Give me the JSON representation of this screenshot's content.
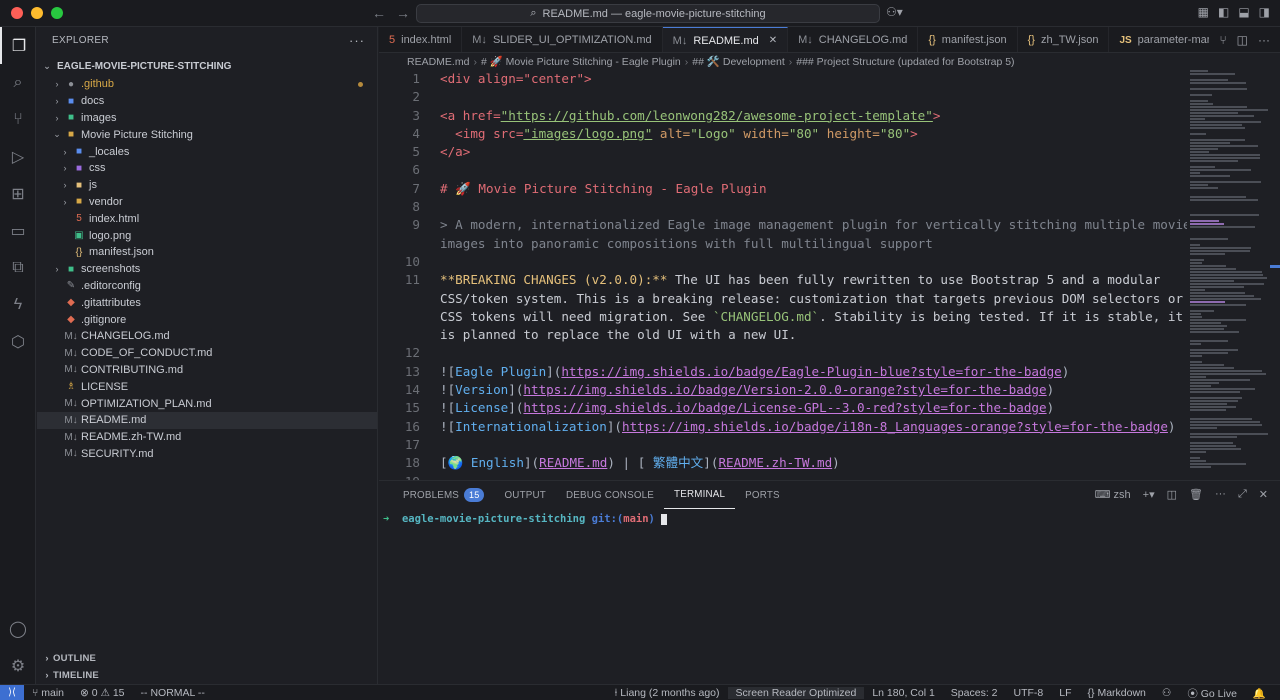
{
  "window": {
    "title": "README.md — eagle-movie-picture-stitching"
  },
  "sidebar": {
    "header": "EXPLORER",
    "project": "EAGLE-MOVIE-PICTURE-STITCHING",
    "items": [
      {
        "label": ".github",
        "icon": "github-folder-icon"
      },
      {
        "label": "docs",
        "icon": "folder-icon"
      },
      {
        "label": "images",
        "icon": "folder-icon"
      },
      {
        "label": "Movie Picture Stitching",
        "icon": "folder-open-icon"
      },
      {
        "label": "_locales",
        "icon": "folder-icon"
      },
      {
        "label": "css",
        "icon": "folder-icon"
      },
      {
        "label": "js",
        "icon": "folder-icon"
      },
      {
        "label": "vendor",
        "icon": "folder-icon"
      },
      {
        "label": "index.html",
        "icon": "html-file-icon"
      },
      {
        "label": "logo.png",
        "icon": "image-file-icon"
      },
      {
        "label": "manifest.json",
        "icon": "json-file-icon"
      },
      {
        "label": "screenshots",
        "icon": "folder-icon"
      },
      {
        "label": ".editorconfig",
        "icon": "config-file-icon"
      },
      {
        "label": ".gitattributes",
        "icon": "git-file-icon"
      },
      {
        "label": ".gitignore",
        "icon": "git-file-icon"
      },
      {
        "label": "CHANGELOG.md",
        "icon": "markdown-file-icon"
      },
      {
        "label": "CODE_OF_CONDUCT.md",
        "icon": "markdown-file-icon"
      },
      {
        "label": "CONTRIBUTING.md",
        "icon": "markdown-file-icon"
      },
      {
        "label": "LICENSE",
        "icon": "license-file-icon"
      },
      {
        "label": "OPTIMIZATION_PLAN.md",
        "icon": "markdown-file-icon"
      },
      {
        "label": "README.md",
        "icon": "markdown-file-icon"
      },
      {
        "label": "README.zh-TW.md",
        "icon": "markdown-file-icon"
      },
      {
        "label": "SECURITY.md",
        "icon": "markdown-file-icon"
      }
    ],
    "outline": "OUTLINE",
    "timeline": "TIMELINE"
  },
  "tabs": [
    {
      "label": "index.html",
      "icon": "html-file-icon"
    },
    {
      "label": "SLIDER_UI_OPTIMIZATION.md",
      "icon": "markdown-file-icon"
    },
    {
      "label": "README.md",
      "icon": "markdown-file-icon"
    },
    {
      "label": "CHANGELOG.md",
      "icon": "markdown-file-icon"
    },
    {
      "label": "manifest.json",
      "icon": "json-file-icon"
    },
    {
      "label": "zh_TW.json",
      "icon": "json-file-icon"
    },
    {
      "label": "parameter-manage",
      "icon": "js-file-icon"
    }
  ],
  "breadcrumb": [
    "README.md",
    "# 🚀 Movie Picture Stitching - Eagle Plugin",
    "## 🛠️ Development",
    "### Project Structure (updated for Bootstrap 5)"
  ],
  "editor": {
    "line_numbers": [
      "1",
      "2",
      "3",
      "4",
      "5",
      "6",
      "7",
      "8",
      "9",
      "",
      "10",
      "11",
      "",
      "",
      "",
      "12",
      "13",
      "14",
      "15",
      "16",
      "17",
      "18",
      "19"
    ],
    "l1": "<div align=\"center\">",
    "l3_a": "<a href=",
    "l3_url": "\"https://github.com/leonwong282/awesome-project-template\"",
    "l3_b": ">",
    "l4_a": "  <img src=",
    "l4_src": "\"images/logo.png\"",
    "l4_b": " alt=",
    "l4_alt": "\"Logo\"",
    "l4_c": " width=",
    "l4_w": "\"80\"",
    "l4_d": " height=",
    "l4_h": "\"80\"",
    "l4_e": ">",
    "l5": "</a>",
    "l7": "# 🚀 Movie Picture Stitching - Eagle Plugin",
    "l9_1": "> A modern, internationalized Eagle image management plugin for vertically stitching multiple movie",
    "l9_2": "images into panoramic compositions with full multilingual support",
    "l11_bold": "**BREAKING CHANGES (v2.0.0):**",
    "l11_1": " The UI has been fully rewritten to use Bootstrap 5 and a modular",
    "l11_2": "CSS/token system. This is a breaking release: customization that targets previous DOM selectors or",
    "l11_3a": "CSS tokens will need migration. See ",
    "l11_3code": "`CHANGELOG.md`",
    "l11_3b": ". Stability is being tested. If it is stable, it",
    "l11_4": "is planned to replace the old UI with a new UI.",
    "badges": [
      {
        "alt": "Eagle Plugin",
        "url": "https://img.shields.io/badge/Eagle-Plugin-blue?style=for-the-badge"
      },
      {
        "alt": "Version",
        "url": "https://img.shields.io/badge/Version-2.0.0-orange?style=for-the-badge"
      },
      {
        "alt": "License",
        "url": "https://img.shields.io/badge/License-GPL--3.0-red?style=for-the-badge"
      },
      {
        "alt": "Internationalization",
        "url": "https://img.shields.io/badge/i18n-8_Languages-orange?style=for-the-badge"
      }
    ],
    "l18_en": "🌍 English",
    "l18_en_link": "README.md",
    "l18_sep": " | [",
    "l18_zh": " 繁體中文",
    "l18_zh_link": "README.zh-TW.md"
  },
  "panel": {
    "tabs": [
      "PROBLEMS",
      "OUTPUT",
      "DEBUG CONSOLE",
      "TERMINAL",
      "PORTS"
    ],
    "problems_count": "15",
    "shell": "zsh",
    "prompt_arrow": "➜",
    "prompt_dir": "eagle-movie-picture-stitching",
    "prompt_git": "git:(",
    "prompt_branch": "main",
    "prompt_close": ")"
  },
  "status": {
    "branch": "main",
    "errors": "0",
    "warnings": "15",
    "mode": "-- NORMAL --",
    "blame": "Liang (2 months ago)",
    "screen_reader": "Screen Reader Optimized",
    "position": "Ln 180, Col 1",
    "spaces": "Spaces: 2",
    "encoding": "UTF-8",
    "eol": "LF",
    "language": "Markdown",
    "golive": "Go Live"
  },
  "colors": {
    "accent": "#4a7cd6",
    "badge": "#4a7cd6",
    "remote": "#3d6fd1"
  }
}
